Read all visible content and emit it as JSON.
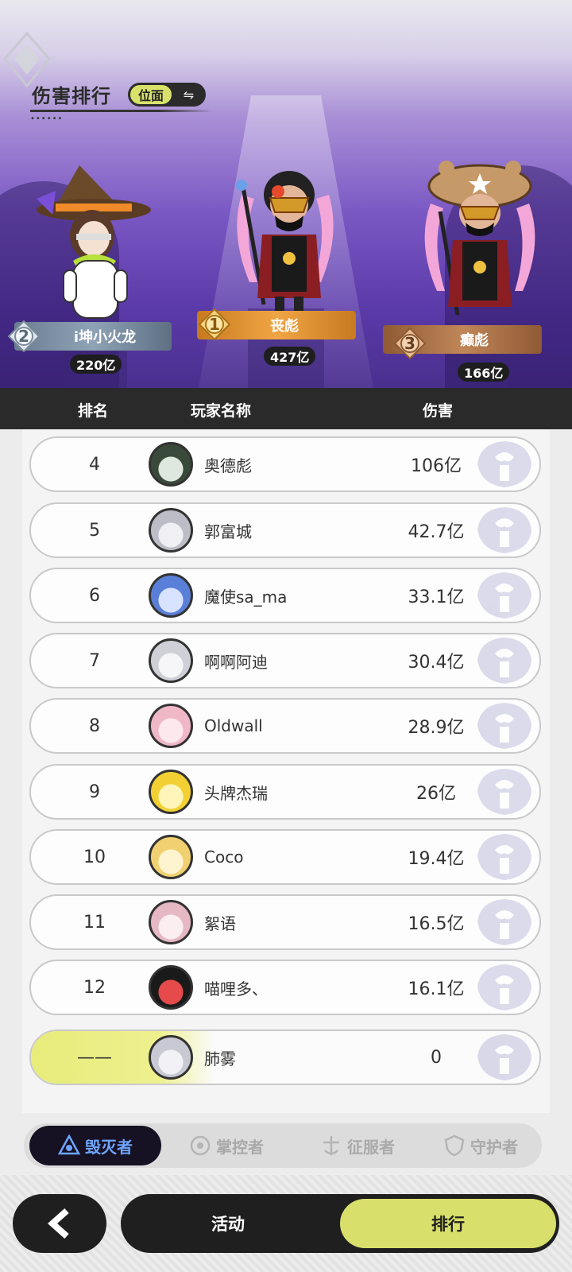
{
  "header": {
    "title": "伤害排行",
    "plane_button_label": "位面",
    "plane_swap_icon": "swap-icon"
  },
  "podium": [
    {
      "rank": "2",
      "name": "i坤小火龙",
      "damage": "220亿"
    },
    {
      "rank": "1",
      "name": "丧彪",
      "damage": "427亿"
    },
    {
      "rank": "3",
      "name": "癫彪",
      "damage": "166亿"
    }
  ],
  "table_header": {
    "rank": "排名",
    "player": "玩家名称",
    "damage": "伤害"
  },
  "rows": [
    {
      "rank": "4",
      "name": "奥德彪",
      "damage": "106亿"
    },
    {
      "rank": "5",
      "name": "郭富城",
      "damage": "42.7亿"
    },
    {
      "rank": "6",
      "name": "魔使sa_ma",
      "damage": "33.1亿"
    },
    {
      "rank": "7",
      "name": "啊啊阿迪",
      "damage": "30.4亿"
    },
    {
      "rank": "8",
      "name": "Oldwall",
      "damage": "28.9亿"
    },
    {
      "rank": "9",
      "name": "头牌杰瑞",
      "damage": "26亿"
    },
    {
      "rank": "10",
      "name": "Coco",
      "damage": "19.4亿"
    },
    {
      "rank": "11",
      "name": "絮语",
      "damage": "16.5亿"
    },
    {
      "rank": "12",
      "name": "喵哩多、",
      "damage": "16.1亿"
    }
  ],
  "self_row": {
    "rank": "——",
    "name": "肺雾",
    "damage": "0"
  },
  "categories": [
    {
      "label": "毁灭者",
      "active": true
    },
    {
      "label": "掌控者",
      "active": false
    },
    {
      "label": "征服者",
      "active": false
    },
    {
      "label": "守护者",
      "active": false
    }
  ],
  "bottom_nav": {
    "back_icon": "chevron-left-icon",
    "activity": "活动",
    "ranking": "排行",
    "active": "排行"
  },
  "colors": {
    "accent_yellow": "#d8df6a",
    "active_tab_text": "#6ea6ff",
    "dark": "#1f1f1f",
    "gold": "#f0a545",
    "silver": "#8fa3b7",
    "bronze": "#c08658"
  }
}
